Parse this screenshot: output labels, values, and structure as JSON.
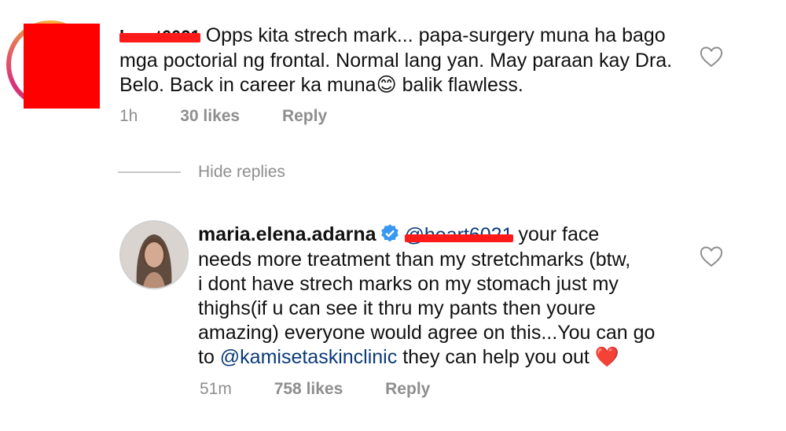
{
  "comment1": {
    "username_redacted": "heart6021",
    "text": "Opps kita strech mark... papa-surgery muna ha bago mga poctorial ng frontal. Normal lang yan. May paraan kay Dra. Belo. Back in career ka muna",
    "emoji": "😊",
    "text_after_emoji": " balik flawless.",
    "time": "1h",
    "likes": "30 likes",
    "reply": "Reply"
  },
  "thread": {
    "hide_replies": "Hide replies"
  },
  "reply1": {
    "username": "maria.elena.adarna",
    "mention_redacted": "@heart6021",
    "line1": " your face",
    "line2": "needs more treatment than my stretchmarks (btw,",
    "line3": "i dont have strech marks on my stomach just my",
    "line4": "thighs(if u can see it thru my pants then youre",
    "line5": "amazing) everyone would agree on this...You can go",
    "line6_pre": "to ",
    "mention": "@kamisetaskinclinic",
    "line6_post": " they can help you out ",
    "heart_emoji": "❤️",
    "time": "51m",
    "likes": "758 likes",
    "reply": "Reply"
  },
  "icons": {
    "like": "heart-outline-icon",
    "verified": "verified-badge-icon"
  },
  "colors": {
    "redaction": "#ff0000",
    "verified_blue": "#3897f0",
    "mention": "#0a3a78",
    "meta_gray": "#8e8e8e"
  }
}
